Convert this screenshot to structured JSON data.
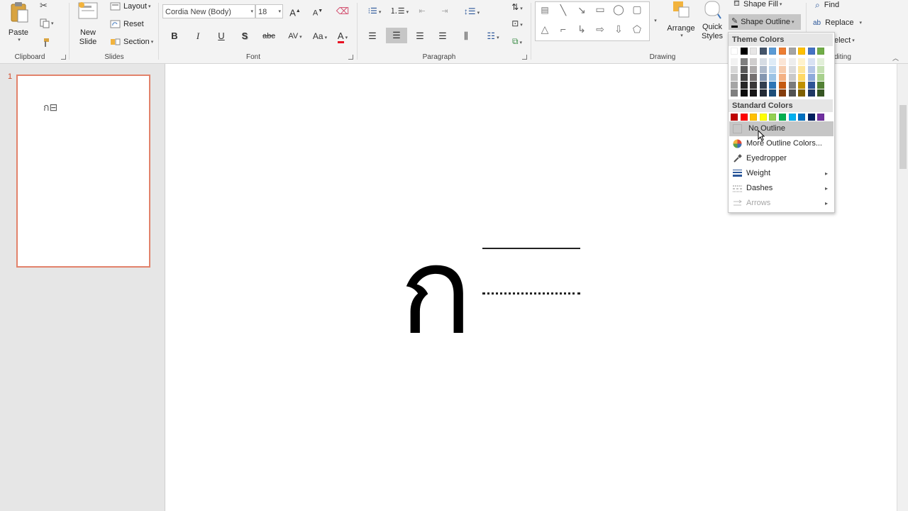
{
  "ribbon": {
    "clipboard": {
      "paste_label": "Paste",
      "group_label": "Clipboard"
    },
    "slides": {
      "new_slide_label": "New Slide",
      "layout_label": "Layout",
      "reset_label": "Reset",
      "section_label": "Section",
      "group_label": "Slides"
    },
    "font": {
      "font_name": "Cordia New (Body)",
      "font_size": "18",
      "bold": "B",
      "italic": "I",
      "underline": "U",
      "shadow": "S",
      "strike": "abc",
      "spacing": "AV",
      "case": "Aa",
      "color": "A",
      "grow": "A",
      "shrink": "A",
      "group_label": "Font"
    },
    "paragraph": {
      "group_label": "Paragraph"
    },
    "drawing": {
      "arrange_label": "Arrange",
      "quick_styles_label": "Quick Styles",
      "shape_fill_label": "Shape Fill",
      "shape_outline_label": "Shape Outline",
      "group_label": "Drawing"
    },
    "editing": {
      "find_label": "Find",
      "replace_label": "Replace",
      "select_label": "elect",
      "group_label": "diting"
    }
  },
  "thumbnails": {
    "slide_number": "1",
    "thumb_text": "ก⊟"
  },
  "slide": {
    "glyph": "ก"
  },
  "outline_menu": {
    "theme_header": "Theme Colors",
    "theme_top_row": [
      "#ffffff",
      "#000000",
      "#e7e6e6",
      "#44546a",
      "#5b9bd5",
      "#ed7d31",
      "#a5a5a5",
      "#ffc000",
      "#4472c4",
      "#70ad47"
    ],
    "theme_shades": [
      [
        "#f2f2f2",
        "#7f7f7f",
        "#d0cece",
        "#d6dce4",
        "#deebf6",
        "#fbe5d5",
        "#ededed",
        "#fff2cc",
        "#d9e2f3",
        "#e2efd9"
      ],
      [
        "#d8d8d8",
        "#595959",
        "#aeabab",
        "#adb9ca",
        "#bdd7ee",
        "#f7cbac",
        "#dbdbdb",
        "#fee599",
        "#b4c6e7",
        "#c5e0b3"
      ],
      [
        "#bfbfbf",
        "#3f3f3f",
        "#757070",
        "#8496b0",
        "#9cc3e5",
        "#f4b183",
        "#c9c9c9",
        "#ffd965",
        "#8eaadb",
        "#a8d08d"
      ],
      [
        "#a5a5a5",
        "#262626",
        "#3a3838",
        "#323f4f",
        "#2e75b5",
        "#c55a11",
        "#7b7b7b",
        "#bf9000",
        "#2f5496",
        "#538135"
      ],
      [
        "#7f7f7f",
        "#0c0c0c",
        "#171616",
        "#222a35",
        "#1e4e79",
        "#843c0b",
        "#525252",
        "#7f6000",
        "#1f3864",
        "#375623"
      ]
    ],
    "standard_header": "Standard Colors",
    "standard_colors": [
      "#c00000",
      "#ff0000",
      "#ffc000",
      "#ffff00",
      "#92d050",
      "#00b050",
      "#00b0f0",
      "#0070c0",
      "#002060",
      "#7030a0"
    ],
    "items": [
      {
        "label": "No Outline",
        "icon": "no-outline-icon"
      },
      {
        "label": "More Outline Colors...",
        "icon": "color-wheel-icon"
      },
      {
        "label": "Eyedropper",
        "icon": "eyedropper-icon"
      },
      {
        "label": "Weight",
        "icon": "weight-icon"
      },
      {
        "label": "Dashes",
        "icon": "dashes-icon"
      },
      {
        "label": "Arrows",
        "icon": "arrows-icon"
      }
    ]
  }
}
